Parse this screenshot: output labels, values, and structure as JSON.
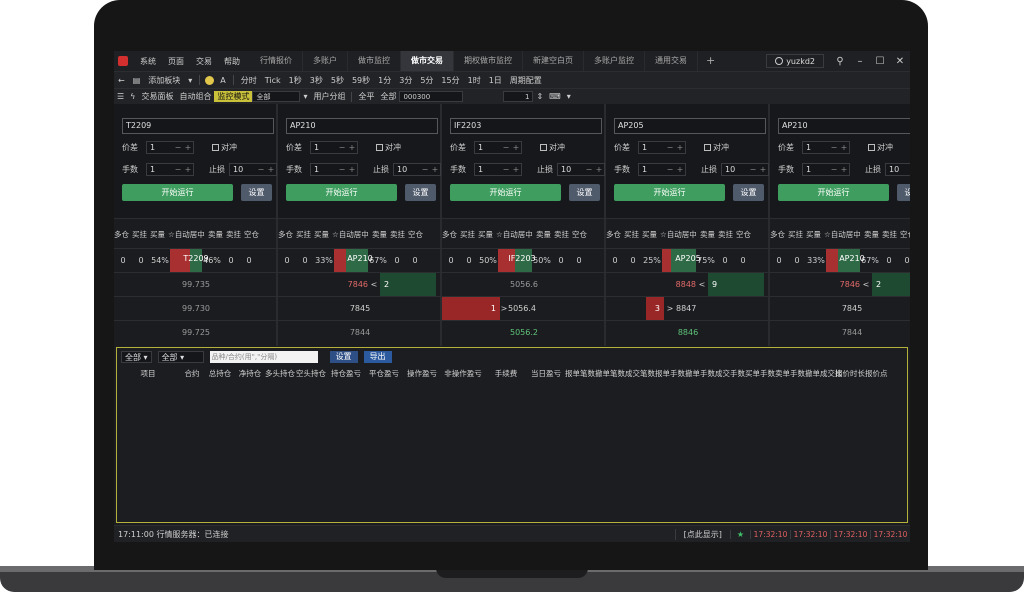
{
  "menu": [
    "系统",
    "页面",
    "交易",
    "帮助"
  ],
  "tabs": [
    "行情报价",
    "多账户",
    "做市监控",
    "做市交易",
    "期权做市监控",
    "新建空白页",
    "多账户监控",
    "通用交易"
  ],
  "active_tab": 3,
  "tab_add": "+",
  "user": "yuzkd2",
  "toolbar1": {
    "add_board": "添加板块",
    "periods": [
      "分时",
      "Tick",
      "1秒",
      "3秒",
      "5秒",
      "59秒",
      "1分",
      "3分",
      "5分",
      "15分",
      "1时",
      "1日",
      "周期配置"
    ]
  },
  "toolbar2": {
    "trade_panel": "交易面板",
    "auto_combo": "自动组合",
    "monitor_mode": "监控模式",
    "all_select": "全部",
    "account_group": "用户分组",
    "flat": "全平",
    "account_label": "全部",
    "account_value": "000300",
    "qty": "1"
  },
  "panels": [
    {
      "code": "T2209",
      "spread_label": "价差",
      "spread": "1",
      "hedge": "对冲",
      "lots_label": "手数",
      "lots": "1",
      "stop_label": "止损",
      "stop": "10",
      "start": "开始运行",
      "settings": "设置"
    },
    {
      "code": "AP210",
      "spread_label": "价差",
      "spread": "1",
      "hedge": "对冲",
      "lots_label": "手数",
      "lots": "1",
      "stop_label": "止损",
      "stop": "10",
      "start": "开始运行",
      "settings": "设置"
    },
    {
      "code": "IF2203",
      "spread_label": "价差",
      "spread": "1",
      "hedge": "对冲",
      "lots_label": "手数",
      "lots": "1",
      "stop_label": "止损",
      "stop": "10",
      "start": "开始运行",
      "settings": "设置"
    },
    {
      "code": "AP205",
      "spread_label": "价差",
      "spread": "1",
      "hedge": "对冲",
      "lots_label": "手数",
      "lots": "1",
      "stop_label": "止损",
      "stop": "10",
      "start": "开始运行",
      "settings": "设置"
    },
    {
      "code": "AP210",
      "spread_label": "价差",
      "spread": "1",
      "hedge": "对冲",
      "lots_label": "手数",
      "lots": "1",
      "stop_label": "止损",
      "stop": "10",
      "start": "开始运行",
      "settings": "设置"
    }
  ],
  "ladder_header": [
    "多仓",
    "买挂",
    "买量",
    "☆自动居中",
    "卖量",
    "卖挂",
    "空仓"
  ],
  "ladders": [
    {
      "top": [
        "0",
        "0",
        "54%",
        "T2209",
        "46%",
        "0",
        "0"
      ],
      "prices": [
        "99.735",
        "99.730",
        "99.725"
      ]
    },
    {
      "top": [
        "0",
        "0",
        "33%",
        "AP210",
        "67%",
        "0",
        "0"
      ],
      "prices": [
        "7846",
        "7845",
        "7844"
      ],
      "bid_ask": [
        "<",
        "2"
      ]
    },
    {
      "top": [
        "0",
        "0",
        "50%",
        "IF2203",
        "50%",
        "0",
        "0"
      ],
      "prices": [
        "5056.6",
        "5056.4",
        "5056.2"
      ],
      "bid_qty": "1",
      "marker": ">"
    },
    {
      "top": [
        "0",
        "0",
        "25%",
        "AP205",
        "75%",
        "0",
        "0"
      ],
      "prices": [
        "8848",
        "8847",
        "8846"
      ],
      "bid_ask": [
        "<",
        "9"
      ],
      "bid_qty": "3",
      "marker": ">"
    },
    {
      "top": [
        "0",
        "0",
        "33%",
        "AP210",
        "67%",
        "0",
        "0"
      ],
      "prices": [
        "7846",
        "7845",
        "7844"
      ],
      "bid_ask": [
        "<",
        "2"
      ]
    }
  ],
  "bottom": {
    "filter1": "全部",
    "filter2": "全部",
    "placeholder": "品种/合约(用\",\"分隔)",
    "settings": "设置",
    "export": "导出",
    "columns": [
      "项目",
      "合约",
      "总持仓",
      "净持仓",
      "多头持仓",
      "空头持仓",
      "持仓盈亏",
      "平仓盈亏",
      "操作盈亏",
      "非操作盈亏",
      "手续费",
      "当日盈亏",
      "报单笔数",
      "撤单笔数",
      "成交笔数",
      "报单手数",
      "撤单手数",
      "成交手数",
      "买单手数",
      "卖单手数",
      "撤单成交比",
      "报价时长",
      "报价点"
    ]
  },
  "status": {
    "left": "17:11:00 行情服务器：已连接",
    "click_show": "[点此显示]",
    "star": "★",
    "times": [
      "17:32:10",
      "17:32:10",
      "17:32:10",
      "17:32:10"
    ]
  },
  "colors": {
    "accent": "#c9c13a",
    "start_green": "#3f9e5f",
    "bid_red": "#a93030",
    "ask_green": "#2e6a46"
  }
}
